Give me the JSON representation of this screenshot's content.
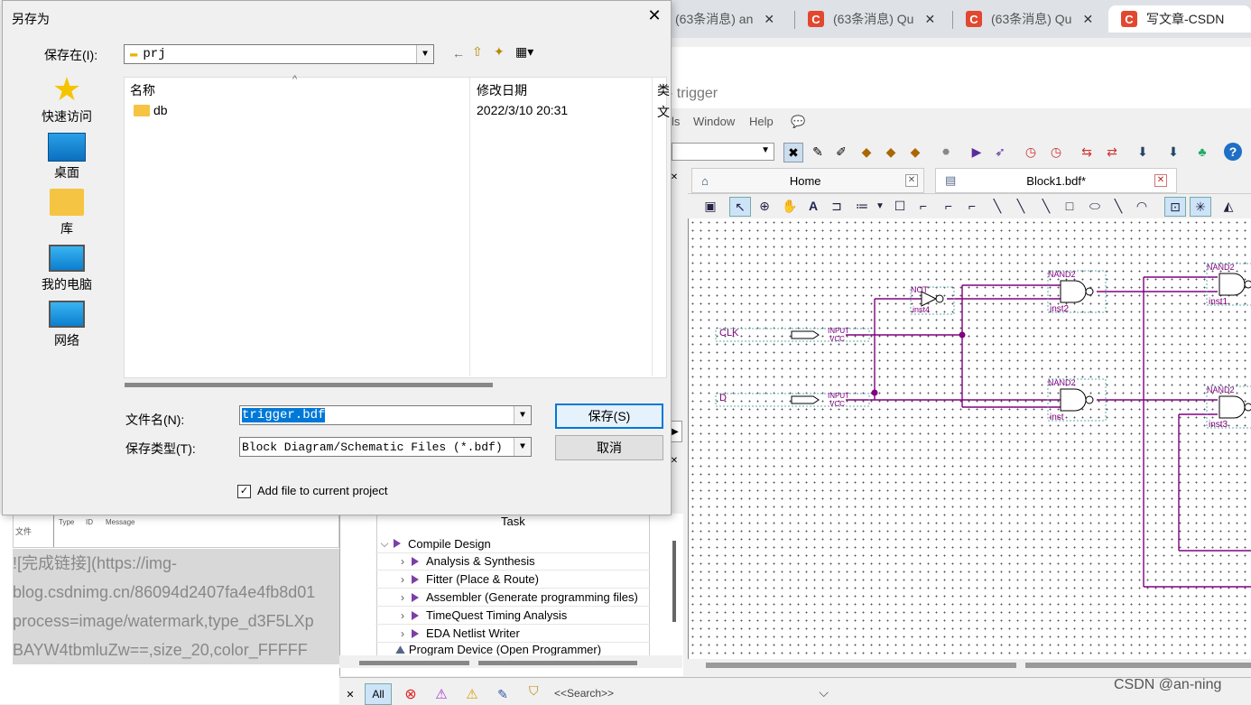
{
  "browser": {
    "tabs": [
      {
        "label": "(63条消息) an",
        "active": false
      },
      {
        "label": "(63条消息) Qu",
        "active": false
      },
      {
        "label": "(63条消息) Qu",
        "active": false
      },
      {
        "label": "写文章-CSDN",
        "active": true
      }
    ],
    "brand_color": "#e2472f"
  },
  "quartus": {
    "title_suffix": "- trigger",
    "menu": [
      "ls",
      "Window",
      "Help"
    ],
    "doc_tabs": [
      {
        "label": "Home"
      },
      {
        "label": "Block1.bdf*"
      }
    ],
    "schematic": {
      "pins": [
        {
          "name": "CLK",
          "type": "INPUT",
          "sub": "VCC"
        },
        {
          "name": "D",
          "type": "INPUT",
          "sub": "VCC"
        }
      ],
      "gates": [
        {
          "type": "NOT",
          "inst": "inst4"
        },
        {
          "type": "NAND2",
          "inst": "inst2"
        },
        {
          "type": "NAND2",
          "inst": "inst"
        },
        {
          "type": "NAND2",
          "inst": "inst1"
        },
        {
          "type": "NAND2",
          "inst": "inst3"
        }
      ],
      "wire_color": "#800080"
    },
    "tasks": {
      "header": "Task",
      "items": [
        {
          "label": "Compile Design",
          "level": 0,
          "expanded": true
        },
        {
          "label": "Analysis & Synthesis",
          "level": 1
        },
        {
          "label": "Fitter (Place & Route)",
          "level": 1
        },
        {
          "label": "Assembler (Generate programming files)",
          "level": 1
        },
        {
          "label": "TimeQuest Timing Analysis",
          "level": 1
        },
        {
          "label": "EDA Netlist Writer",
          "level": 1
        },
        {
          "label": "Program Device (Open Programmer)",
          "level": 0
        }
      ]
    },
    "messages": {
      "columns": [
        "Type",
        "ID",
        "Message"
      ],
      "side_label": "文件",
      "filter_all": "All",
      "search_placeholder": "<<Search>>"
    }
  },
  "markdown_text": [
    "![完成链接](https://img-",
    "blog.csdnimg.cn/86094d2407fa4e4fb8d01",
    "process=image/watermark,type_d3F5LXp",
    "BAYW4tbmluZw==,size_20,color_FFFFF"
  ],
  "dialog": {
    "title": "另存为",
    "save_in_label": "保存在(I):",
    "save_in_value": "prj",
    "places": [
      {
        "label": "快速访问",
        "icon": "star-icon"
      },
      {
        "label": "桌面",
        "icon": "desktop-icon"
      },
      {
        "label": "库",
        "icon": "library-folder-icon"
      },
      {
        "label": "我的电脑",
        "icon": "computer-icon"
      },
      {
        "label": "网络",
        "icon": "network-icon"
      }
    ],
    "columns": {
      "name": "名称",
      "modified": "修改日期",
      "type": "类"
    },
    "files": [
      {
        "name": "db",
        "modified": "2022/3/10 20:31",
        "type": "文"
      }
    ],
    "filename_label": "文件名(N):",
    "filename_value": "trigger.bdf",
    "filetype_label": "保存类型(T):",
    "filetype_value": "Block Diagram/Schematic Files (*.bdf)",
    "save_button": "保存(S)",
    "cancel_button": "取消",
    "add_to_project_label": "Add file to current project",
    "add_to_project_checked": true
  },
  "watermark": "CSDN @an-ning"
}
